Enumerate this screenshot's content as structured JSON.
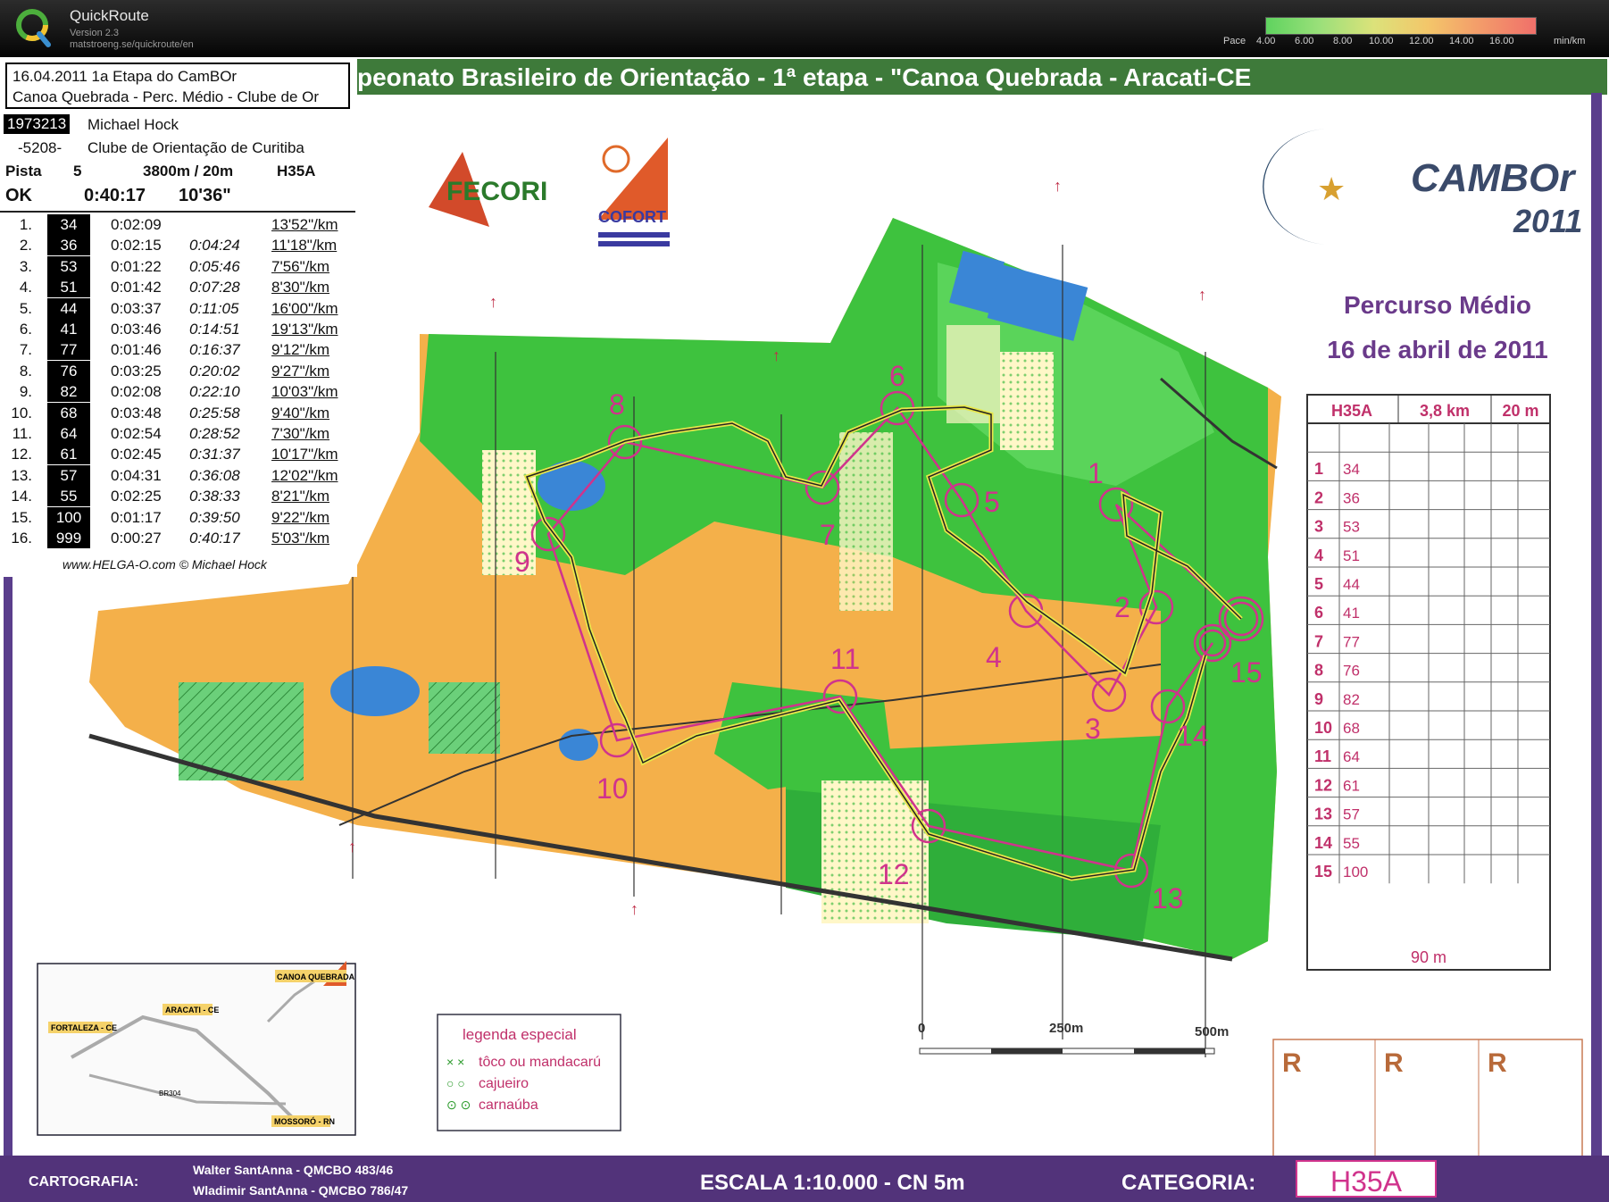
{
  "app": {
    "name": "QuickRoute",
    "version": "Version 2.3",
    "url": "matstroeng.se/quickroute/en"
  },
  "pace_scale": {
    "label": "Pace",
    "ticks": [
      "4.00",
      "6.00",
      "8.00",
      "10.00",
      "12.00",
      "14.00",
      "16.00"
    ],
    "unit": "min/km",
    "colors": [
      "#5fd35f",
      "#9be07a",
      "#dce27a",
      "#f3c66a",
      "#f39a6a",
      "#f0706a"
    ]
  },
  "session": {
    "date_line": "16.04.2011   1a Etapa do CamBOr",
    "event_line": "Canoa Quebrada - Perc. Médio - Clube de Or",
    "runner_id": "1973213",
    "runner_name": "Michael Hock",
    "club_code": "-5208-",
    "club_name": "Clube de Orientação de Curitiba",
    "pista_label": "Pista",
    "pista_value": "5",
    "course_length": "3800m / 20m",
    "category": "H35A",
    "status": "OK",
    "total_time": "0:40:17",
    "avg_pace": "10'36\"",
    "credit": "www.HELGA-O.com © Michael Hock"
  },
  "splits": [
    {
      "n": "1.",
      "code": "34",
      "time": "0:02:09",
      "cum": "",
      "pace": "13'52\"/km"
    },
    {
      "n": "2.",
      "code": "36",
      "time": "0:02:15",
      "cum": "0:04:24",
      "pace": "11'18\"/km"
    },
    {
      "n": "3.",
      "code": "53",
      "time": "0:01:22",
      "cum": "0:05:46",
      "pace": "7'56\"/km"
    },
    {
      "n": "4.",
      "code": "51",
      "time": "0:01:42",
      "cum": "0:07:28",
      "pace": "8'30\"/km"
    },
    {
      "n": "5.",
      "code": "44",
      "time": "0:03:37",
      "cum": "0:11:05",
      "pace": "16'00\"/km"
    },
    {
      "n": "6.",
      "code": "41",
      "time": "0:03:46",
      "cum": "0:14:51",
      "pace": "19'13\"/km"
    },
    {
      "n": "7.",
      "code": "77",
      "time": "0:01:46",
      "cum": "0:16:37",
      "pace": "9'12\"/km"
    },
    {
      "n": "8.",
      "code": "76",
      "time": "0:03:25",
      "cum": "0:20:02",
      "pace": "9'27\"/km"
    },
    {
      "n": "9.",
      "code": "82",
      "time": "0:02:08",
      "cum": "0:22:10",
      "pace": "10'03\"/km"
    },
    {
      "n": "10.",
      "code": "68",
      "time": "0:03:48",
      "cum": "0:25:58",
      "pace": "9'40\"/km"
    },
    {
      "n": "11.",
      "code": "64",
      "time": "0:02:54",
      "cum": "0:28:52",
      "pace": "7'30\"/km"
    },
    {
      "n": "12.",
      "code": "61",
      "time": "0:02:45",
      "cum": "0:31:37",
      "pace": "10'17\"/km"
    },
    {
      "n": "13.",
      "code": "57",
      "time": "0:04:31",
      "cum": "0:36:08",
      "pace": "12'02\"/km"
    },
    {
      "n": "14.",
      "code": "55",
      "time": "0:02:25",
      "cum": "0:38:33",
      "pace": "8'21\"/km"
    },
    {
      "n": "15.",
      "code": "100",
      "time": "0:01:17",
      "cum": "0:39:50",
      "pace": "9'22\"/km"
    },
    {
      "n": "16.",
      "code": "999",
      "time": "0:00:27",
      "cum": "0:40:17",
      "pace": "5'03\"/km"
    }
  ],
  "map": {
    "banner": "peonato Brasileiro de Orientação - 1ª etapa - \"Canoa Quebrada - Aracati-CE",
    "fecori": "FECORI",
    "cofort": "COFORT",
    "cambor": "CAMBOr",
    "cambor_year": "2011",
    "course_name": "Percurso Médio",
    "course_date": "16 de abril de 2011",
    "scale_labels": [
      "0",
      "250m",
      "500m"
    ],
    "legend_title": "legenda especial",
    "legend_items": [
      "tôco ou mandacarú",
      "cajueiro",
      "carnaúba"
    ],
    "inset_labels": [
      "CANOA QUEBRADA",
      "ARACATI - CE",
      "FORTALEZA - CE",
      "BR304",
      "MOSSORÓ - RN"
    ],
    "cartografia_label": "CARTOGRAFIA:",
    "cartografia_1": "Walter SantAnna - QMCBO 483/46",
    "cartografia_2": "Wladimir SantAnna - QMCBO 786/47",
    "escala": "ESCALA 1:10.000 - CN 5m",
    "categoria_label": "CATEGORIA:",
    "categoria_value": "H35A",
    "r_boxes": [
      "R",
      "R",
      "R"
    ],
    "control_labels": [
      "1",
      "2",
      "3",
      "4",
      "5",
      "6",
      "7",
      "8",
      "9",
      "10",
      "11",
      "12",
      "13",
      "14",
      "15"
    ],
    "description_sheet": {
      "header": [
        "H35A",
        "3,8 km",
        "20 m"
      ],
      "rows": [
        {
          "n": "1",
          "code": "34"
        },
        {
          "n": "2",
          "code": "36"
        },
        {
          "n": "3",
          "code": "53"
        },
        {
          "n": "4",
          "code": "51"
        },
        {
          "n": "5",
          "code": "44"
        },
        {
          "n": "6",
          "code": "41"
        },
        {
          "n": "7",
          "code": "77"
        },
        {
          "n": "8",
          "code": "76"
        },
        {
          "n": "9",
          "code": "82"
        },
        {
          "n": "10",
          "code": "68"
        },
        {
          "n": "11",
          "code": "64"
        },
        {
          "n": "12",
          "code": "61"
        },
        {
          "n": "13",
          "code": "57"
        },
        {
          "n": "14",
          "code": "55"
        },
        {
          "n": "15",
          "code": "100"
        }
      ],
      "finish_distance": "90 m"
    }
  }
}
